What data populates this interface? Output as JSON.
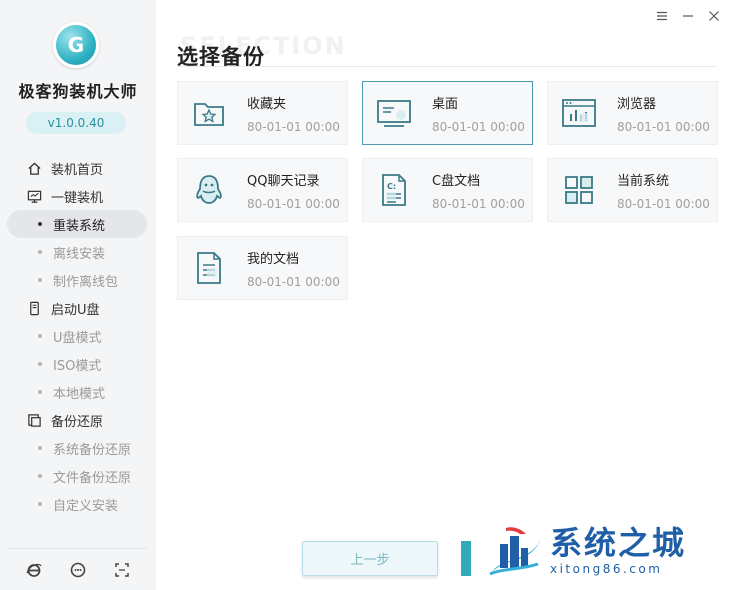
{
  "app": {
    "name": "极客狗装机大师",
    "version": "v1.0.0.40",
    "logo_letter": "G"
  },
  "sidebar": {
    "items": [
      {
        "type": "main",
        "icon": "home-icon",
        "label": "装机首页"
      },
      {
        "type": "main",
        "icon": "monitor-icon",
        "label": "一键装机"
      },
      {
        "type": "sub",
        "label": "重装系统",
        "active": true
      },
      {
        "type": "sub",
        "label": "离线安装"
      },
      {
        "type": "sub",
        "label": "制作离线包"
      },
      {
        "type": "main",
        "icon": "usb-drive-icon",
        "label": "启动U盘"
      },
      {
        "type": "sub",
        "label": "U盘模式"
      },
      {
        "type": "sub",
        "label": "ISO模式"
      },
      {
        "type": "sub",
        "label": "本地模式"
      },
      {
        "type": "main",
        "icon": "backup-icon",
        "label": "备份还原"
      },
      {
        "type": "sub",
        "label": "系统备份还原"
      },
      {
        "type": "sub",
        "label": "文件备份还原"
      },
      {
        "type": "sub",
        "label": "自定义安装"
      }
    ],
    "footer_icons": [
      "browser-e-icon",
      "support-chat-icon",
      "fullscreen-icon"
    ]
  },
  "window": {
    "controls": [
      "menu-icon",
      "minimize-icon",
      "close-icon"
    ]
  },
  "main": {
    "watermark_title": "SELECTION",
    "title": "选择备份",
    "cards": [
      {
        "name": "收藏夹",
        "date": "80-01-01 00:00",
        "icon": "favorites-folder-icon",
        "selected": false
      },
      {
        "name": "桌面",
        "date": "80-01-01 00:00",
        "icon": "desktop-icon",
        "selected": true
      },
      {
        "name": "浏览器",
        "date": "80-01-01 00:00",
        "icon": "browser-window-icon",
        "selected": false
      },
      {
        "name": "QQ聊天记录",
        "date": "80-01-01 00:00",
        "icon": "qq-penguin-icon",
        "selected": false
      },
      {
        "name": "C盘文档",
        "date": "80-01-01 00:00",
        "icon": "c-drive-document-icon",
        "selected": false
      },
      {
        "name": "当前系统",
        "date": "80-01-01 00:00",
        "icon": "system-grid-icon",
        "selected": false
      },
      {
        "name": "我的文档",
        "date": "80-01-01 00:00",
        "icon": "my-documents-icon",
        "selected": false
      }
    ],
    "prev_button": "上一步"
  },
  "watermark": {
    "cn": "系统之城",
    "en": "xitong86.com"
  },
  "colors": {
    "accent": "#34a9b6",
    "icon": "#3a7a88",
    "selected_border": "#4a9aab"
  }
}
